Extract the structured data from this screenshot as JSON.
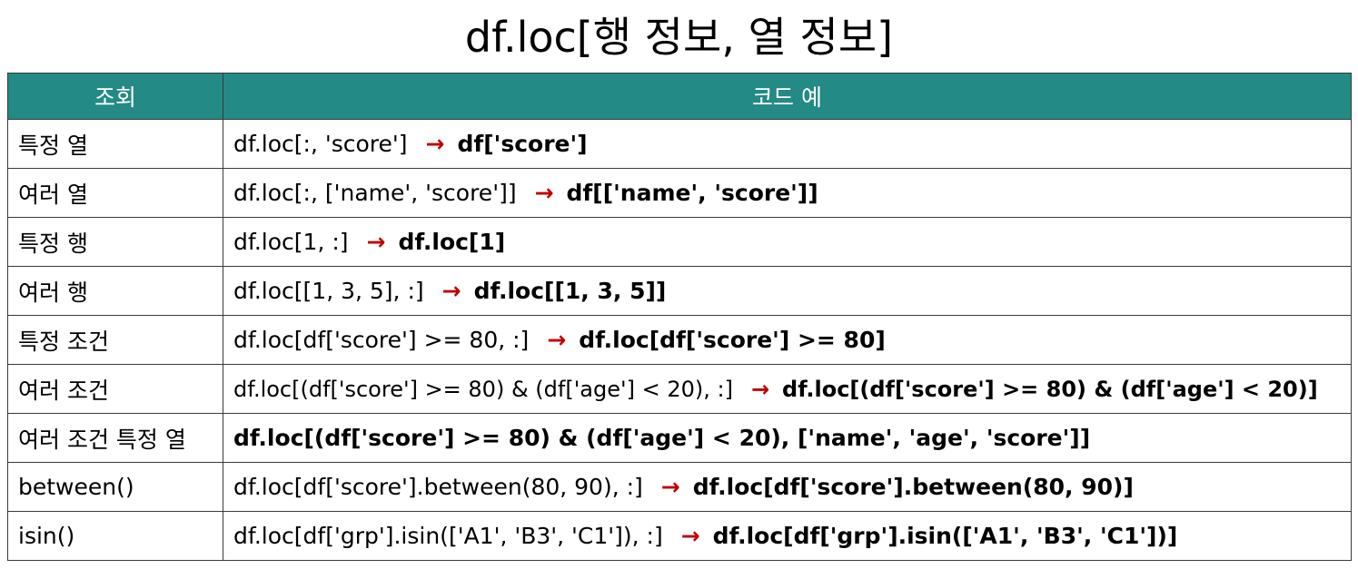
{
  "title": "df.loc[행 정보, 열 정보]",
  "header": {
    "query": "조회",
    "code": "코드 예"
  },
  "arrow_symbol": "→",
  "colors": {
    "header_bg": "#238a85",
    "header_text": "#ffffff",
    "arrow": "#c00000",
    "border": "#3a3a3a"
  },
  "rows": [
    {
      "query": "특정 열",
      "full": "df.loc[:, 'score']",
      "short": "df['score']"
    },
    {
      "query": "여러 열",
      "full": "df.loc[:, ['name', 'score']]",
      "short": "df[['name', 'score']]"
    },
    {
      "query": "특정 행",
      "full": "df.loc[1, :]",
      "short": "df.loc[1]"
    },
    {
      "query": "여러 행",
      "full": "df.loc[[1, 3, 5], :]",
      "short": "df.loc[[1, 3, 5]]"
    },
    {
      "query": "특정 조건",
      "full": "df.loc[df['score'] >= 80, :]",
      "short": "df.loc[df['score'] >= 80]"
    },
    {
      "query": "여러 조건",
      "full": "df.loc[(df['score'] >= 80) & (df['age'] < 20), :]",
      "short": "df.loc[(df['score'] >= 80) & (df['age'] < 20)]"
    },
    {
      "query": "여러 조건 특정 열",
      "full": "",
      "short": "df.loc[(df['score'] >= 80) & (df['age'] < 20), ['name', 'age', 'score']]"
    },
    {
      "query": "between()",
      "full": "df.loc[df['score'].between(80, 90), :]",
      "short": "df.loc[df['score'].between(80, 90)]"
    },
    {
      "query": "isin()",
      "full": "df.loc[df['grp'].isin(['A1', 'B3', 'C1']), :]",
      "short": "df.loc[df['grp'].isin(['A1', 'B3', 'C1'])]"
    }
  ]
}
